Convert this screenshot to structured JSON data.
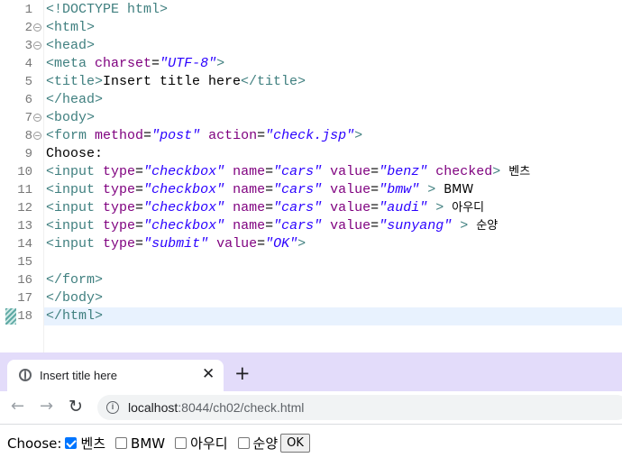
{
  "editor": {
    "line_numbers": [
      "1",
      "2",
      "3",
      "4",
      "5",
      "6",
      "7",
      "8",
      "9",
      "10",
      "11",
      "12",
      "13",
      "14",
      "15",
      "16",
      "17",
      "18"
    ],
    "code": {
      "l1_tag": "<!DOCTYPE html>",
      "l2_tag": "<html>",
      "l3_tag": "<head>",
      "l4_open": "<meta",
      "l4_attr": "charset",
      "l4_val": "\"UTF-8\"",
      "l4_close": ">",
      "l5_open": "<title>",
      "l5_text": "Insert title here",
      "l5_close": "</title>",
      "l6_tag": "</head>",
      "l7_tag": "<body>",
      "l8_open": "<form",
      "l8_attr1": "method",
      "l8_val1": "\"post\"",
      "l8_attr2": "action",
      "l8_val2": "\"check.jsp\"",
      "l8_close": ">",
      "l9_text": "Choose:",
      "input_open": "<input",
      "attr_type": "type",
      "attr_name": "name",
      "attr_value": "value",
      "val_checkbox": "\"checkbox\"",
      "val_cars": "\"cars\"",
      "l10_value": "\"benz\"",
      "l10_checked": "checked",
      "l10_close": ">",
      "l10_text": "벤츠",
      "l11_value": "\"bmw\"",
      "l11_close": ">",
      "l11_text": "BMW",
      "l12_value": "\"audi\"",
      "l12_close": ">",
      "l12_text": "아우디",
      "l13_value": "\"sunyang\"",
      "l13_close": ">",
      "l13_text": "순양",
      "l14_type_val": "\"submit\"",
      "l14_value_val": "\"OK\"",
      "l14_close": ">",
      "l16_tag": "</form>",
      "l17_tag": "</body>",
      "l18_tag": "</html>"
    }
  },
  "browser": {
    "tab_title": "Insert title here",
    "close_icon": "close-icon",
    "new_tab_glyph": "+",
    "back_glyph": "←",
    "forward_glyph": "→",
    "reload_glyph": "↻",
    "url_host": "localhost",
    "url_rest": ":8044/ch02/check.html",
    "tab_strip_color": "#e3dcfa"
  },
  "page": {
    "choose_label": "Choose:",
    "options": [
      {
        "label": "벤츠",
        "checked": true
      },
      {
        "label": "BMW",
        "checked": false
      },
      {
        "label": "아우디",
        "checked": false
      },
      {
        "label": "순양",
        "checked": false
      }
    ],
    "submit_label": "OK"
  },
  "colors": {
    "tag": "#3f7f7f",
    "attribute": "#7f007f",
    "string": "#2a00ff",
    "current_line": "#e8f2fe",
    "checkbox_accent": "#0075ff"
  }
}
